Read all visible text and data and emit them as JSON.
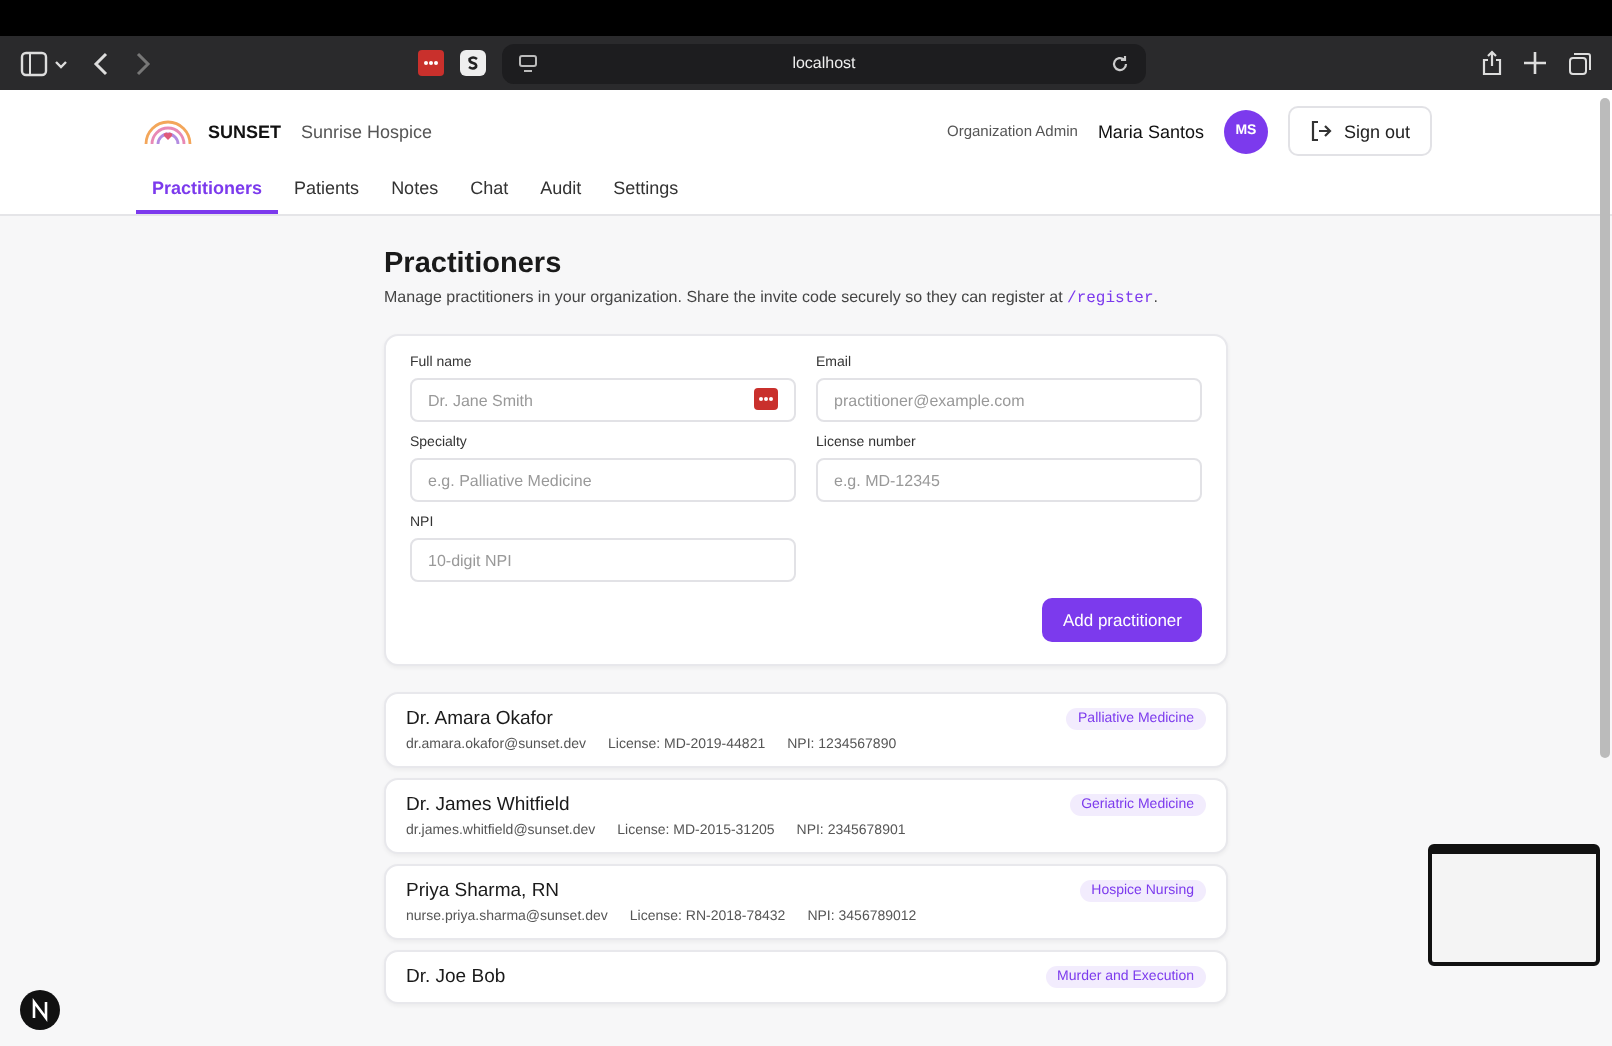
{
  "browser": {
    "url": "localhost"
  },
  "header": {
    "brand": "SUNSET",
    "organization": "Sunrise Hospice",
    "role": "Organization Admin",
    "user": "Maria Santos",
    "avatar": "MS",
    "sign_out": "Sign out"
  },
  "tabs": [
    {
      "label": "Practitioners",
      "selected": true
    },
    {
      "label": "Patients",
      "selected": false
    },
    {
      "label": "Notes",
      "selected": false
    },
    {
      "label": "Chat",
      "selected": false
    },
    {
      "label": "Audit",
      "selected": false
    },
    {
      "label": "Settings",
      "selected": false
    }
  ],
  "page": {
    "title": "Practitioners",
    "description": "Manage practitioners in your organization. Share the invite code securely so they can register at",
    "path": "/register",
    "description_end": "."
  },
  "form": {
    "fields": [
      {
        "label": "Full name",
        "placeholder": "Dr. Jane Smith",
        "autofill": true
      },
      {
        "label": "Email",
        "placeholder": "practitioner@example.com",
        "autofill": false
      },
      {
        "label": "Specialty",
        "placeholder": "e.g. Palliative Medicine",
        "autofill": false
      },
      {
        "label": "License number",
        "placeholder": "e.g. MD-12345",
        "autofill": false
      },
      {
        "label": "NPI",
        "placeholder": "10-digit NPI",
        "autofill": false
      }
    ],
    "submit": "Add practitioner"
  },
  "practitioners": [
    {
      "name": "Dr. Amara Okafor",
      "email": "dr.amara.okafor@sunset.dev",
      "license": "License: MD-2019-44821",
      "npi": "NPI: 1234567890",
      "specialty": "Palliative Medicine"
    },
    {
      "name": "Dr. James Whitfield",
      "email": "dr.james.whitfield@sunset.dev",
      "license": "License: MD-2015-31205",
      "npi": "NPI: 2345678901",
      "specialty": "Geriatric Medicine"
    },
    {
      "name": "Priya Sharma, RN",
      "email": "nurse.priya.sharma@sunset.dev",
      "license": "License: RN-2018-78432",
      "npi": "NPI: 3456789012",
      "specialty": "Hospice Nursing"
    },
    {
      "name": "Dr. Joe Bob",
      "specialty": "Murder and Execution"
    }
  ]
}
